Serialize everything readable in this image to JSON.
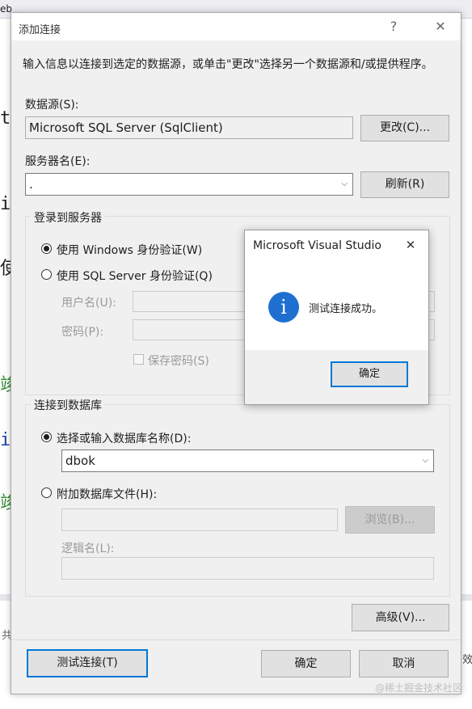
{
  "background": {
    "tab_fragment": "eb",
    "code_fragments": [
      "t",
      "i",
      "使",
      "竣",
      "i",
      "竣"
    ],
    "side_fragments": [
      "共",
      "效"
    ]
  },
  "dialog": {
    "title": "添加连接",
    "help_glyph": "?",
    "close_glyph": "✕",
    "intro": "输入信息以连接到选定的数据源，或单击\"更改\"选择另一个数据源和/或提供程序。",
    "datasource_label": "数据源(S):",
    "datasource_value": "Microsoft SQL Server (SqlClient)",
    "change_button": "更改(C)...",
    "server_label": "服务器名(E):",
    "server_value": ".",
    "refresh_button": "刷新(R)",
    "login_group": "登录到服务器",
    "auth_windows": "使用 Windows 身份验证(W)",
    "auth_sql": "使用 SQL Server 身份验证(Q)",
    "username_label": "用户名(U):",
    "password_label": "密码(P):",
    "save_password": "保存密码(S)",
    "db_group": "连接到数据库",
    "select_db": "选择或输入数据库名称(D):",
    "db_value": "dbok",
    "attach_db": "附加数据库文件(H):",
    "browse_button": "浏览(B)...",
    "logical_label": "逻辑名(L):",
    "advanced_button": "高级(V)...",
    "test_button": "测试连接(T)",
    "ok_button": "确定",
    "cancel_button": "取消"
  },
  "messagebox": {
    "title": "Microsoft Visual Studio",
    "close_glyph": "✕",
    "icon_glyph": "i",
    "message": "测试连接成功。",
    "ok_button": "确定"
  },
  "watermark": "@稀土掘金技术社区"
}
